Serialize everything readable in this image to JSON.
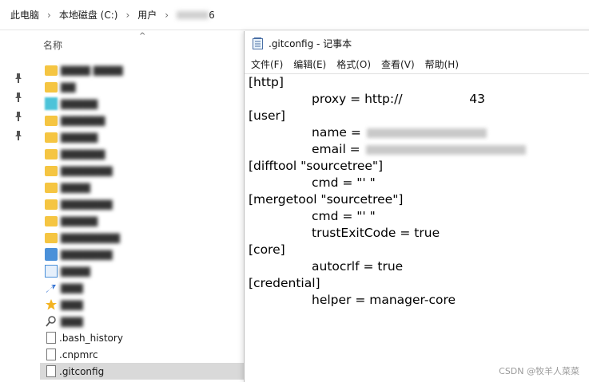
{
  "explorer": {
    "breadcrumb": [
      "此电脑",
      "本地磁盘 (C:)",
      "用户",
      "6"
    ],
    "column_header": "名称",
    "files": [
      ".bash_history",
      ".cnpmrc",
      ".gitconfig"
    ]
  },
  "notepad": {
    "title": ".gitconfig - 记事本",
    "menu": [
      "文件(F)",
      "编辑(E)",
      "格式(O)",
      "查看(V)",
      "帮助(H)"
    ],
    "lines": [
      {
        "text": "[http]",
        "indent": false
      },
      {
        "text": "proxy = http://                 43",
        "indent": true
      },
      {
        "text": "[user]",
        "indent": false
      },
      {
        "text": "name = ",
        "indent": true
      },
      {
        "text": "email = ",
        "indent": true
      },
      {
        "text": "[difftool \"sourcetree\"]",
        "indent": false
      },
      {
        "text": "cmd = \"' \"",
        "indent": true
      },
      {
        "text": "[mergetool \"sourcetree\"]",
        "indent": false
      },
      {
        "text": "cmd = \"' \"",
        "indent": true
      },
      {
        "text": "trustExitCode = true",
        "indent": true
      },
      {
        "text": "[core]",
        "indent": false
      },
      {
        "text": "autocrlf = true",
        "indent": true
      },
      {
        "text": "[credential]",
        "indent": false
      },
      {
        "text": "helper = manager-core",
        "indent": true
      }
    ]
  },
  "watermark": "CSDN @牧羊人菜菜",
  "colors": {
    "folder": "#f5c542",
    "selected_row": "#d9d9d9"
  }
}
